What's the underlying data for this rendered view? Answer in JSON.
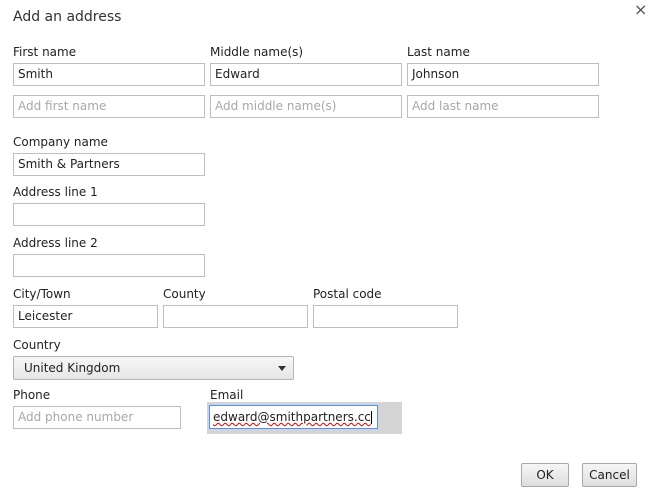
{
  "dialog": {
    "title": "Add an address",
    "close_glyph": "×"
  },
  "name": {
    "first_label": "First name",
    "middle_label": "Middle name(s)",
    "last_label": "Last name",
    "first_value": "Smith",
    "middle_value": "Edward",
    "last_value": "Johnson",
    "first_placeholder": "Add first name",
    "middle_placeholder": "Add middle name(s)",
    "last_placeholder": "Add last name"
  },
  "company": {
    "label": "Company name",
    "value": "Smith & Partners"
  },
  "address1": {
    "label": "Address line 1",
    "value": ""
  },
  "address2": {
    "label": "Address line 2",
    "value": ""
  },
  "city": {
    "label": "City/Town",
    "value": "Leicester"
  },
  "county": {
    "label": "County",
    "value": ""
  },
  "postal": {
    "label": "Postal code",
    "value": ""
  },
  "country": {
    "label": "Country",
    "selected": "United Kingdom"
  },
  "phone": {
    "label": "Phone",
    "placeholder": "Add phone number"
  },
  "email": {
    "label": "Email",
    "value": "edward@smithpartners.cc"
  },
  "buttons": {
    "ok": "OK",
    "cancel": "Cancel"
  }
}
